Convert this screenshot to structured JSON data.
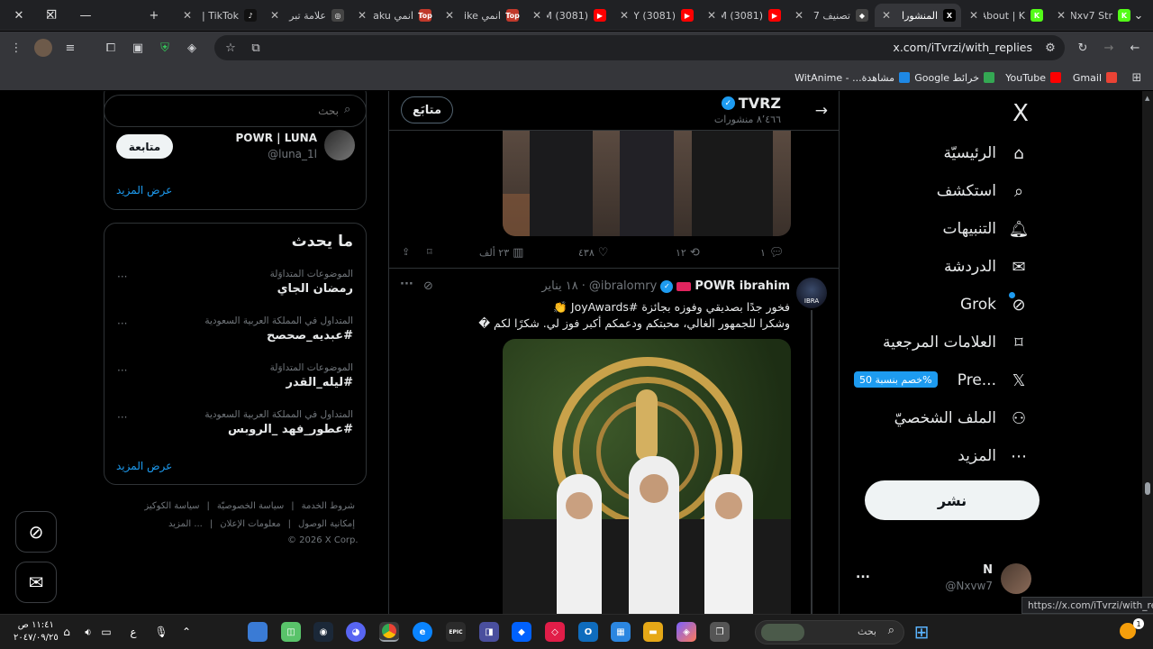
{
  "browser": {
    "tabs": [
      {
        "label": "Nxv7 Str",
        "favicon": "K",
        "color": "#53fc18",
        "active": false
      },
      {
        "label": "About | K",
        "favicon": "K",
        "color": "#53fc18",
        "active": false
      },
      {
        "label": "المنشورا",
        "favicon": "X",
        "color": "#000000",
        "active": true
      },
      {
        "label": "تصنيف 7",
        "favicon": "◆",
        "color": "#444444",
        "active": false
      },
      {
        "label": "(3081) M",
        "favicon": "▶",
        "color": "#ff0000",
        "active": false
      },
      {
        "label": "(3081) Y",
        "favicon": "▶",
        "color": "#ff0000",
        "active": false
      },
      {
        "label": "(3081) M",
        "favicon": "▶",
        "color": "#ff0000",
        "active": false
      },
      {
        "label": "انمي ike",
        "favicon": "Top",
        "color": "#c0392b",
        "active": false
      },
      {
        "label": "انمي aku",
        "favicon": "Top",
        "color": "#c0392b",
        "active": false
      },
      {
        "label": "علامة تبر",
        "favicon": "◎",
        "color": "#444444",
        "active": false
      },
      {
        "label": "TikTok |",
        "favicon": "♪",
        "color": "#111111",
        "active": false
      }
    ],
    "new_tab_label": "+",
    "url": "x.com/iTvrzi/with_replies",
    "bookmarks": [
      {
        "label": "Gmail",
        "color": "#ea4335"
      },
      {
        "label": "YouTube",
        "color": "#ff0000"
      },
      {
        "label": "خرائط Google",
        "color": "#34a853"
      },
      {
        "label": "مشاهدة... - WitAnime",
        "color": "#1e88e5"
      }
    ],
    "status_url": "https://x.com/iTvrzi/with_replies"
  },
  "nav": {
    "logo": "X",
    "items": [
      {
        "label": "الرئيسيّة",
        "icon": "home-icon",
        "glyph": "⌂"
      },
      {
        "label": "استكشف",
        "icon": "search-icon",
        "glyph": "⌕"
      },
      {
        "label": "التنبيهات",
        "icon": "bell-icon",
        "glyph": "🔔︎"
      },
      {
        "label": "الدردشة",
        "icon": "mail-icon",
        "glyph": "✉"
      },
      {
        "label": "Grok",
        "icon": "grok-icon",
        "glyph": "⊘"
      },
      {
        "label": "العلامات المرجعية",
        "icon": "bookmark-icon",
        "glyph": "⌑"
      },
      {
        "label": "...Pre",
        "icon": "x-premium-icon",
        "glyph": "𝕏"
      },
      {
        "label": "الملف الشخصيّ",
        "icon": "profile-icon",
        "glyph": "⚇"
      },
      {
        "label": "المزيد",
        "icon": "more-icon",
        "glyph": "⋯"
      }
    ],
    "premium_badge": "%خصم بنسبة 50",
    "post_button": "نشر",
    "account": {
      "name": "N",
      "handle": "@Nxvw7",
      "more": "..."
    }
  },
  "header": {
    "name": "TVRZ",
    "posts_count": "٨٬٤٦٦ منشورات",
    "follow_button": "متابَع"
  },
  "first_post_actions": {
    "replies": "١",
    "reposts": "١٢",
    "likes": "٤٣٨",
    "views": "٢٣ ألف"
  },
  "post": {
    "author_name": "POWR ibrahim",
    "handle": "@ibralomry",
    "date": "١٨ يناير",
    "text_line1": "فخور جدًا بصديقي وفوزه بجائزة #JoyAwards 👏",
    "text_line2": "وشكرا  للجمهور الغالي، محبتكم ودعمكم أكبر فوز لي. شكرًا لكم �",
    "avatar_text": "IBRA"
  },
  "search": {
    "placeholder": "بحث"
  },
  "who_to_follow": {
    "name": "POWR | LUNA",
    "handle": "@luna_1l",
    "follow": "متابعة",
    "show_more": "عرض المزيد"
  },
  "trends": {
    "title": "ما يحدث",
    "items": [
      {
        "context": "الموضوعات المتداوَلة",
        "name": "رمضان الجاي"
      },
      {
        "context": "المتداول في المملكة العربية السعودية",
        "name": "#عبديه_صحصح"
      },
      {
        "context": "الموضوعات المتداوَلة",
        "name": "#ليله_القدر"
      },
      {
        "context": "المتداول في المملكة العربية السعودية",
        "name": "#عطور_فهد _الروبس"
      }
    ],
    "show_more": "عرض المزيد"
  },
  "footer": {
    "links_row1": [
      "شروط الخدمة",
      "سياسة الخصوصيّة",
      "سياسة الكوكيز"
    ],
    "links_row2": [
      "إمكانية الوصول",
      "معلومات الإعلان",
      "... المزيد"
    ],
    "copyright": "© 2026 X Corp."
  },
  "taskbar": {
    "search_label": "بحث",
    "time": "١١:٤١ ص",
    "date": "٢٠٤٧/٠٩/٢٥",
    "lang": "ع",
    "notification_badge": "1"
  }
}
